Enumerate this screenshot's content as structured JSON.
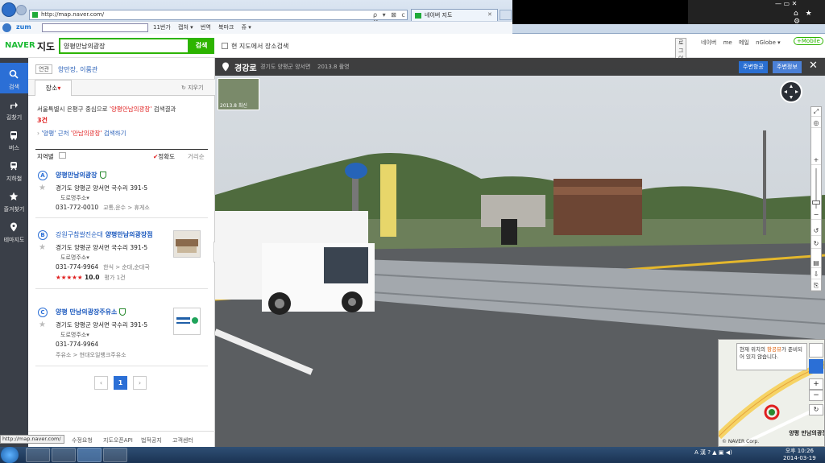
{
  "browser": {
    "url": "http://map.naver.com/",
    "addr_tools": "ρ ▾ ⊠ c ✕",
    "tab_title": "네이버 지도",
    "tab_close": "✕",
    "window_controls": "—   ▭   ✕",
    "right_icons": "⌂ ★ ⚙",
    "zum": {
      "logo": "zum",
      "links": [
        "11번가",
        "캡처 ▾",
        "번역",
        "북마크",
        "쥬 ▾"
      ]
    }
  },
  "header": {
    "brand": "NAVER",
    "section": "지도",
    "search_value": "양평만남의광장",
    "search_button": "검색",
    "here_only_label": "현 지도에서 장소검색",
    "login": "로그인",
    "links": [
      "네이버",
      "me",
      "메일",
      "nGlobe ▾"
    ],
    "mobile": "+Mobile"
  },
  "leftnav": [
    {
      "label": "검색",
      "icon": "search-icon"
    },
    {
      "label": "길찾기",
      "icon": "directions-icon"
    },
    {
      "label": "버스",
      "icon": "bus-icon"
    },
    {
      "label": "지하철",
      "icon": "subway-icon"
    },
    {
      "label": "즐겨찾기",
      "icon": "star-icon"
    },
    {
      "label": "테마지도",
      "icon": "pin-icon"
    }
  ],
  "panel": {
    "related_tag": "연관",
    "related_links": "양만장, 이룸관",
    "tab_label": "장소",
    "tab_arrow": "▾",
    "clear": "↻ 지우기",
    "result_prefix": "서울특별시 은평구 중심으로",
    "result_query": "'양평만남의광장'",
    "result_suffix": "검색결과",
    "result_count": "3건",
    "nearby_prefix": "'양평' 근처",
    "nearby_query": "'만남의광장'",
    "nearby_suffix": "검색하기",
    "region_label": "지역별",
    "sort_accuracy": "정확도",
    "sort_accuracy_mark": "✔",
    "sort_distance": "거리순",
    "results": [
      {
        "marker": "A",
        "name_prefix": "",
        "name": "양평만남의광장",
        "address": "경기도 양평군 양서면 국수리 391-5",
        "road": "도로명주소▾",
        "phone": "031-772-0010",
        "category": "교통,운수 > 휴게소",
        "rating": "",
        "rating_value": "",
        "rating_count": ""
      },
      {
        "marker": "B",
        "name_prefix": "강원구참쌀진순대",
        "name": "양평만남의광장점",
        "address": "경기도 양평군 양서면 국수리 391-5",
        "road": "도로명주소▾",
        "phone": "031-774-9964",
        "category": "한식 > 순대,순대국",
        "rating": "★★★★★",
        "rating_value": "10.0",
        "rating_count": "평가 1건"
      },
      {
        "marker": "C",
        "name_prefix": "",
        "name": "양평 만남의광장주유소",
        "address": "경기도 양평군 양서면 국수리 391-5",
        "road": "도로명주소▾",
        "phone": "031-774-9964",
        "category": "주유소 > 현대오일뱅크주유소",
        "rating": "",
        "rating_value": "",
        "rating_count": ""
      }
    ],
    "page": "1",
    "prev": "‹",
    "next": "›",
    "footer": [
      "수정요청",
      "지도오픈API",
      "법적공지",
      "고객센터"
    ],
    "status_url": "http://map.naver.com/"
  },
  "streetview": {
    "road": "경강로",
    "location": "경기도 양평군 양서면",
    "date": "2013.8 촬영",
    "nearby_photo": "주변항공",
    "nearby_info": "주변정보",
    "thumb_label": "2013.8 최신",
    "minimap_tip_pre": "현재 위치의",
    "minimap_tip_link": "항공뷰",
    "minimap_tip_post": "가 준비되어 있지 않습니다.",
    "minimap_place": "양평 만남의광장",
    "minimap_copy": "© NAVER Corp."
  },
  "taskbar": {
    "tray": "A 漢 ? ▲ ▣ ◀)",
    "time": "오후 10:26",
    "date": "2014-03-19"
  }
}
